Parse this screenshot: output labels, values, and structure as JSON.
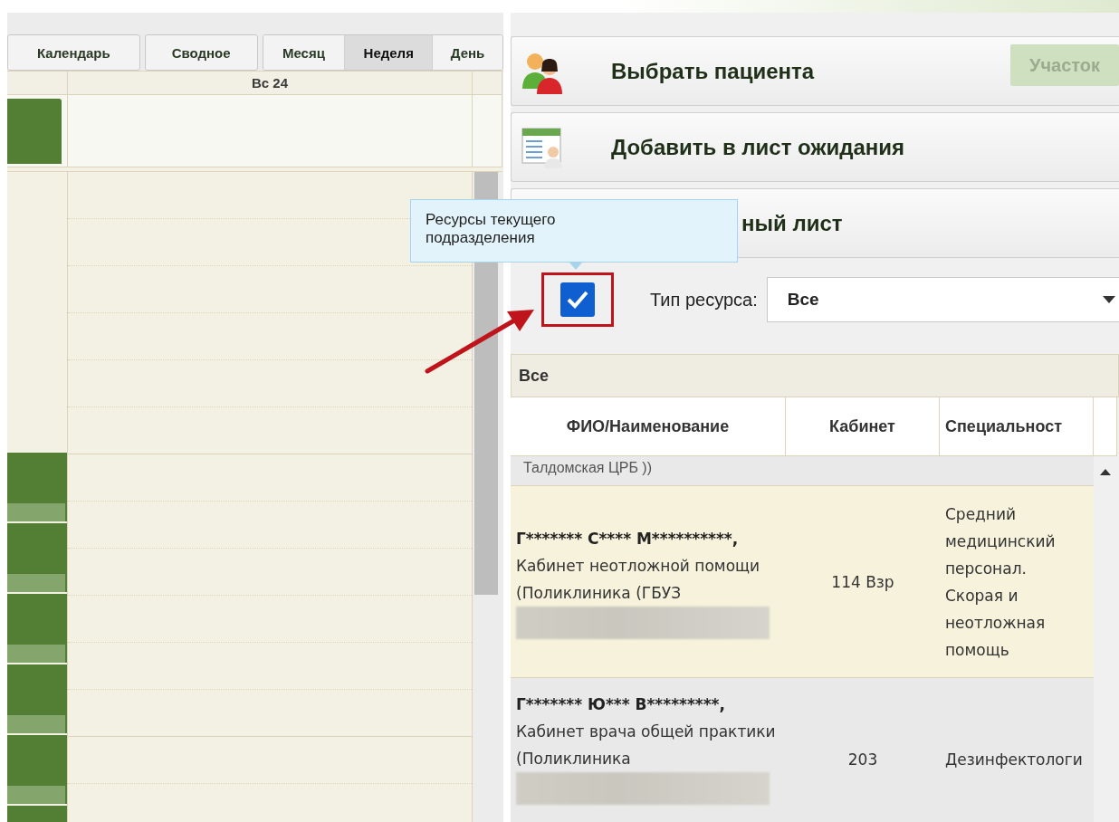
{
  "calendar": {
    "view_buttons": [
      {
        "label": "Календарь",
        "selected": false
      },
      {
        "label": "Сводное",
        "selected": false
      }
    ],
    "range_buttons": [
      {
        "label": "Месяц",
        "selected": false
      },
      {
        "label": "Неделя",
        "selected": true
      },
      {
        "label": "День",
        "selected": false
      }
    ],
    "day_header": "Вс 24"
  },
  "panels": [
    {
      "kind": "patient",
      "title": "Выбрать пациента",
      "button": "Участок"
    },
    {
      "kind": "waitlist",
      "title": "Добавить в лист ожидания"
    },
    {
      "kind": "sheet",
      "title": "ный лист"
    }
  ],
  "tooltip": "Ресурсы текущего подразделения",
  "current_unit_checkbox": {
    "checked": true
  },
  "resource_type": {
    "label": "Тип ресурса:",
    "value": "Все"
  },
  "group": "Все",
  "table": {
    "columns": [
      "ФИО/Наименование",
      "Кабинет",
      "Специальност"
    ],
    "partial_row": "Талдомская ЦРБ ))",
    "rows": [
      {
        "name": "Г******* С**** М**********,",
        "place": "Кабинет неотложной помощи (Поликлиника (ГБУЗ",
        "room": "114 Взр",
        "specialty": "Средний медицинский персонал. Скорая и неотложная помощь",
        "selected": true
      },
      {
        "name": "Г******* Ю*** В*********,",
        "place": "Кабинет врача общей практики (Поликлиника",
        "room": "203",
        "specialty": "Дезинфектологи",
        "selected": false
      }
    ]
  }
}
